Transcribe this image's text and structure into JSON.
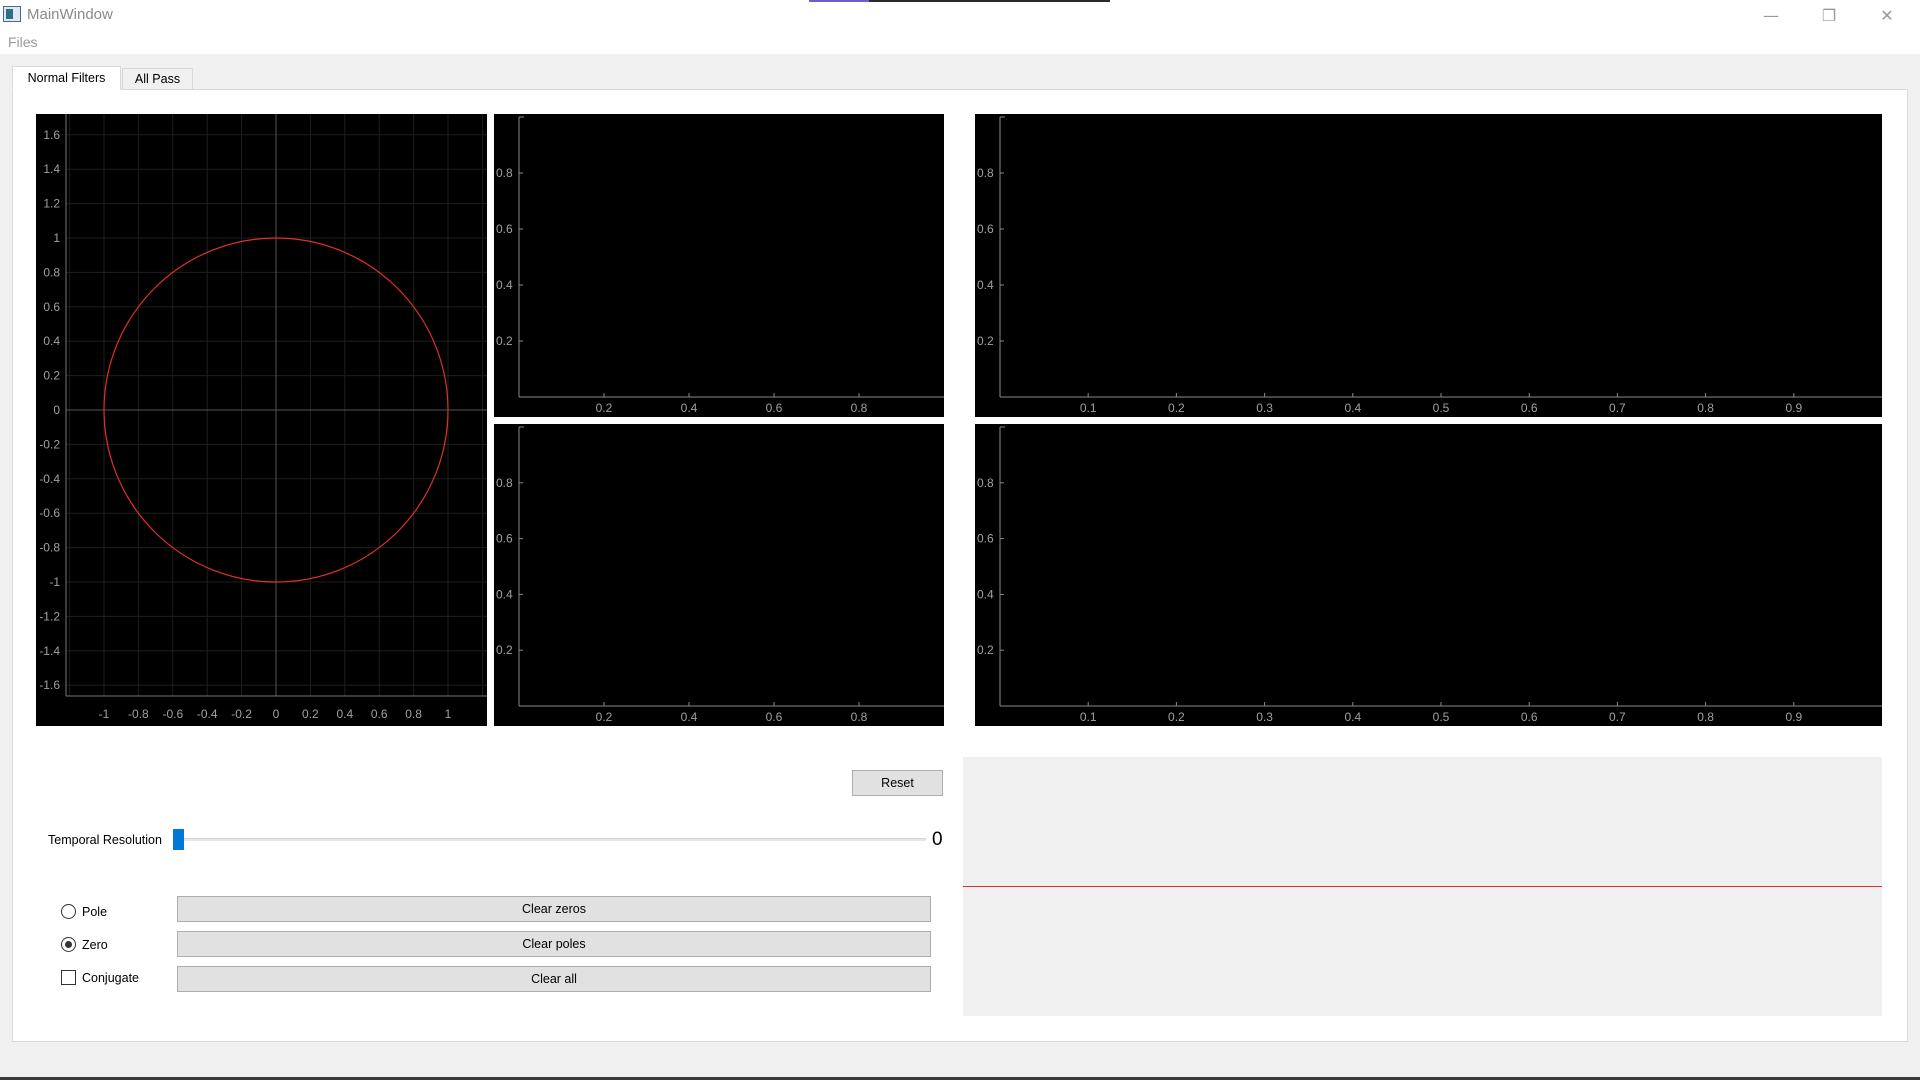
{
  "window": {
    "title": "MainWindow",
    "controls": {
      "minimize": "—",
      "restore": "❐",
      "close": "✕"
    }
  },
  "menubar": {
    "files": "Files"
  },
  "tabs": [
    {
      "label": "Normal Filters",
      "active": true
    },
    {
      "label": "All Pass",
      "active": false
    }
  ],
  "zplane": {
    "y_ticks": [
      "1.6",
      "1.4",
      "1.2",
      "1",
      "0.8",
      "0.6",
      "0.4",
      "0.2",
      "0",
      "-0.2",
      "-0.4",
      "-0.6",
      "-0.8",
      "-1",
      "-1.2",
      "-1.4",
      "-1.6"
    ],
    "x_ticks": [
      "-1",
      "-0.8",
      "-0.6",
      "-0.4",
      "-0.2",
      "0",
      "0.2",
      "0.4",
      "0.6",
      "0.8",
      "1"
    ],
    "unit_circle_color": "#e0302a"
  },
  "small_plots": {
    "y_ticks": [
      "0.8",
      "0.6",
      "0.4",
      "0.2"
    ],
    "x_ticks": [
      "0.2",
      "0.4",
      "0.6",
      "0.8"
    ]
  },
  "wide_plots": {
    "y_ticks": [
      "0.8",
      "0.6",
      "0.4",
      "0.2"
    ],
    "x_ticks": [
      "0.1",
      "0.2",
      "0.3",
      "0.4",
      "0.5",
      "0.6",
      "0.7",
      "0.8",
      "0.9"
    ]
  },
  "controls": {
    "reset": "Reset",
    "temporal_resolution_label": "Temporal Resolution",
    "temporal_resolution_value": "0",
    "pole_label": "Pole",
    "zero_label": "Zero",
    "conjugate_label": "Conjugate",
    "pole_checked": false,
    "zero_checked": true,
    "conjugate_checked": false,
    "clear_zeros": "Clear zeros",
    "clear_poles": "Clear poles",
    "clear_all": "Clear all"
  },
  "colors": {
    "plot_background": "#000000",
    "trace": "#e0302a",
    "slider_handle": "#0078d7"
  }
}
